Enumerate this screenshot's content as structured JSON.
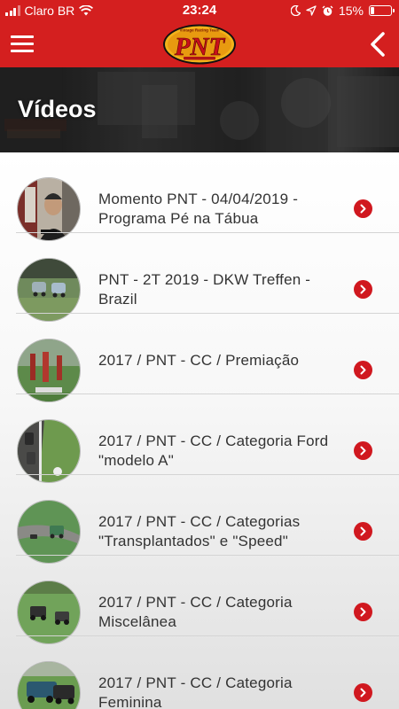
{
  "status_bar": {
    "carrier": "Claro BR",
    "time": "23:24",
    "battery": "15%",
    "battery_level": 0.15
  },
  "nav": {
    "logo_text": "PNT",
    "logo_tagline": "Vintage Racing Team"
  },
  "banner": {
    "title": "Vídeos"
  },
  "videos": [
    {
      "title": "Momento PNT - 04/04/2019 - Programa Pé na Tábua"
    },
    {
      "title": "PNT - 2T 2019 - DKW Treffen - Brazil"
    },
    {
      "title": "2017 / PNT - CC / Premiação"
    },
    {
      "title": "2017 / PNT - CC / Categoria Ford \"modelo A\""
    },
    {
      "title": "2017 / PNT - CC / Categorias \"Transplantados\" e \"Speed\""
    },
    {
      "title": "2017 / PNT - CC / Categoria Miscelânea"
    },
    {
      "title": "2017 / PNT - CC / Categoria Feminina"
    }
  ],
  "colors": {
    "brand_red": "#d41f1f",
    "chevron_red": "#d0181f"
  }
}
